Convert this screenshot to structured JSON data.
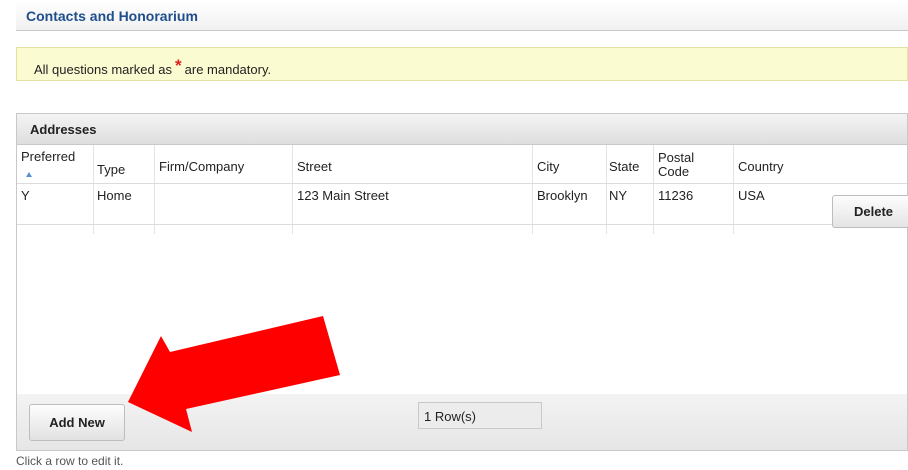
{
  "section": {
    "title": "Contacts and Honorarium"
  },
  "notice": {
    "prefix": "All questions marked as",
    "asterisk": "*",
    "suffix": "are mandatory."
  },
  "addresses": {
    "caption": "Addresses",
    "columns": {
      "preferred": "Preferred",
      "type": "Type",
      "firm": "Firm/Company",
      "street": "Street",
      "city": "City",
      "state": "State",
      "postal_line1": "Postal",
      "postal_line2": "Code",
      "country": "Country"
    },
    "rows": [
      {
        "preferred": "Y",
        "type": "Home",
        "firm": "",
        "street": "123 Main Street",
        "city": "Brooklyn",
        "state": "NY",
        "postal": "11236",
        "country": "USA"
      }
    ],
    "delete_label": "Delete",
    "add_label": "Add New",
    "row_count": "1 Row(s)"
  },
  "hint": "Click a row to edit it.",
  "colors": {
    "title": "#1f4e8c",
    "notice_bg": "#fbfbd2",
    "asterisk": "#e02020",
    "arrow": "#ff0000"
  }
}
